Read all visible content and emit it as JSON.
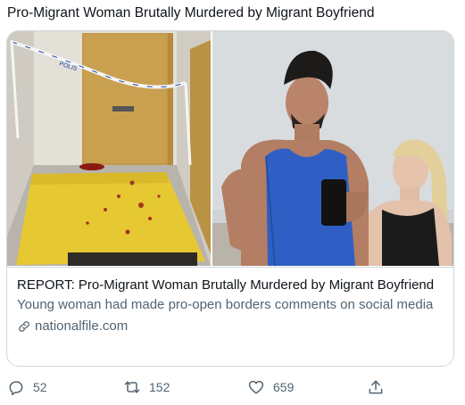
{
  "tweet": {
    "text": "Pro-Migrant Woman Brutally Murdered by Migrant Boyfriend"
  },
  "card": {
    "title": "REPORT: Pro-Migrant Woman Brutally Murdered by Migrant Boyfriend",
    "description": "Young woman had made pro-open borders comments on social media",
    "domain": "nationalfile.com",
    "domain_icon": "link-icon",
    "images": {
      "left": "crime-scene-hallway-with-police-tape",
      "right": "couple-mirror-selfie-gym"
    },
    "tape_text": "POLIS"
  },
  "actions": {
    "reply_count": "52",
    "retweet_count": "152",
    "like_count": "659",
    "reply_icon": "reply-icon",
    "retweet_icon": "retweet-icon",
    "like_icon": "heart-icon",
    "share_icon": "share-icon"
  },
  "colors": {
    "text": "#0f1419",
    "secondary": "#536471",
    "border": "#cfd9de"
  }
}
